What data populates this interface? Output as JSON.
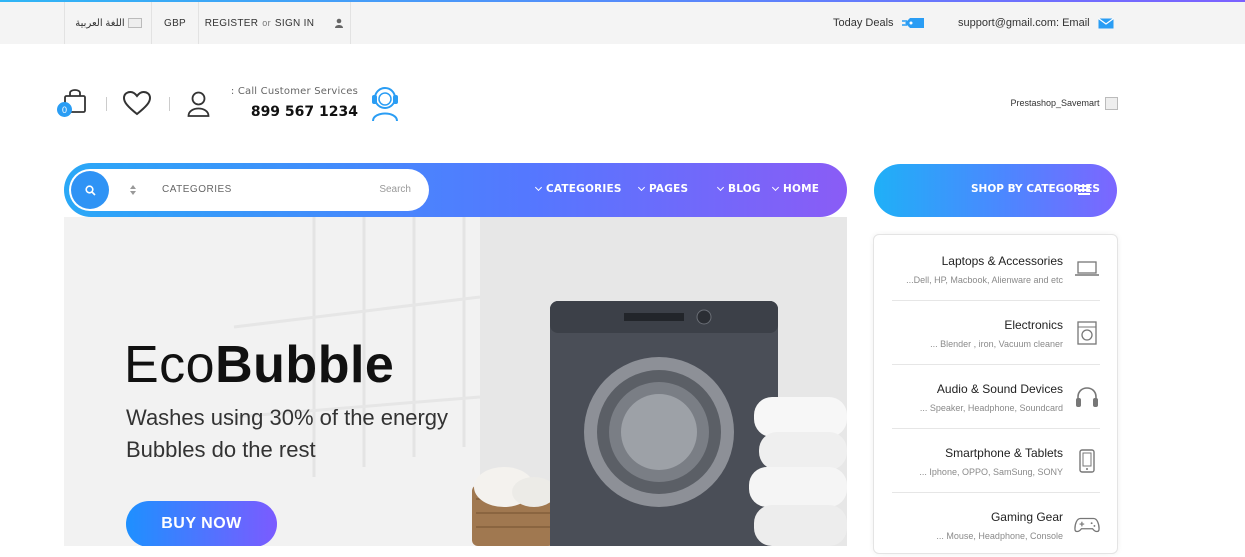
{
  "topbar": {
    "language": "اللغة العربية",
    "currency": "GBP",
    "register": "REGISTER",
    "or": "or",
    "signin": "SIGN IN",
    "today_deals": "Today Deals",
    "email": "support@gmail.com: Email"
  },
  "header": {
    "cart_count": "0",
    "customer_service_label": ": Call Customer Services",
    "phone": "899 567 1234",
    "logo_alt": "Prestashop_Savemart"
  },
  "nav": {
    "categories_label": "CATEGORIES",
    "search_placeholder": "Search",
    "items": [
      {
        "label": "CATEGORIES"
      },
      {
        "label": "PAGES"
      },
      {
        "label": "BLOG"
      },
      {
        "label": "HOME"
      }
    ]
  },
  "shop_by_categories": "SHOP BY CATEGORIES",
  "banner": {
    "brand_light": "Eco",
    "brand_bold": "Bubble",
    "line1": "Washes using 30% of the energy",
    "line2": "Bubbles do the rest",
    "cta": "BUY NOW"
  },
  "categories": [
    {
      "title": "Laptops & Accessories",
      "sub": "...Dell, HP, Macbook, Alienware and etc",
      "icon": "laptop-icon"
    },
    {
      "title": "Electronics",
      "sub": "... Blender , iron, Vacuum cleaner",
      "icon": "washer-icon"
    },
    {
      "title": "Audio & Sound Devices",
      "sub": "... Speaker, Headphone, Soundcard",
      "icon": "headphone-icon"
    },
    {
      "title": "Smartphone & Tablets",
      "sub": "... Iphone, OPPO, SamSung, SONY",
      "icon": "smartphone-icon"
    },
    {
      "title": "Gaming Gear",
      "sub": "... Mouse, Headphone, Console",
      "icon": "gamepad-icon"
    }
  ],
  "colors": {
    "accent_blue": "#2aa8f7",
    "accent_purple": "#8a5cf6",
    "badge": "#2a9df4"
  }
}
